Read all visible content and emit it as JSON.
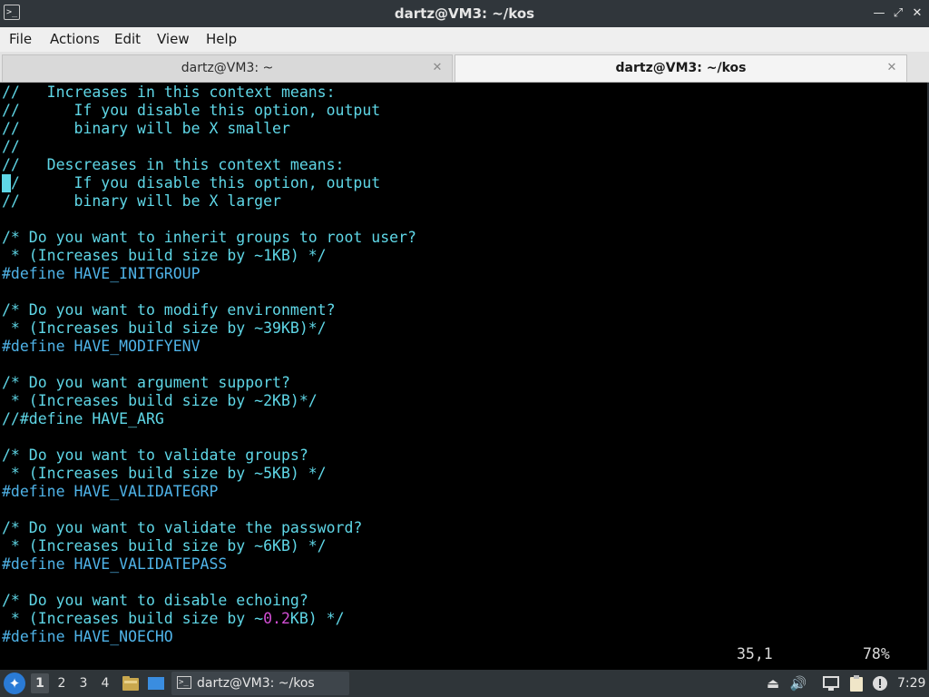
{
  "window": {
    "title": "dartz@VM3: ~/kos",
    "app_icon_glyph": ">_",
    "minimize_glyph": "—",
    "maximize_glyph": "⤢",
    "close_glyph": "✕"
  },
  "menu": [
    "File",
    "Actions",
    "Edit",
    "View",
    "Help"
  ],
  "tabs": [
    {
      "label": "dartz@VM3: ~",
      "active": false,
      "close_glyph": "✕"
    },
    {
      "label": "dartz@VM3: ~/kos",
      "active": true,
      "close_glyph": "✕"
    }
  ],
  "terminal": {
    "lines": [
      "//   Increases in this context means:",
      "//      If you disable this option, output",
      "//      binary will be X smaller",
      "//",
      "//   Descreases in this context means:",
      "//      If you disable this option, output",
      "//      binary will be X larger",
      "",
      "/* Do you want to inherit groups to root user?",
      " * (Increases build size by ~1KB) */",
      "#define HAVE_INITGROUP",
      "",
      "/* Do you want to modify environment?",
      " * (Increases build size by ~39KB)*/",
      "#define HAVE_MODIFYENV",
      "",
      "/* Do you want argument support?",
      " * (Increases build size by ~2KB)*/",
      "//#define HAVE_ARG",
      "",
      "/* Do you want to validate groups?",
      " * (Increases build size by ~5KB) */",
      "#define HAVE_VALIDATEGRP",
      "",
      "/* Do you want to validate the password?",
      " * (Increases build size by ~6KB) */",
      "#define HAVE_VALIDATEPASS",
      "",
      "/* Do you want to disable echoing?",
      " * (Increases build size by ~",
      "#define HAVE_NOECHO"
    ],
    "highlight_number": "0.2",
    "highlight_suffix": "KB) */",
    "cursor_position": "35,1",
    "scroll_percent": "78%",
    "colors": {
      "comment": "#5fd7e7",
      "preproc": "#4fb3e8",
      "number": "#d24ed4",
      "cursor": "#5fd7e7"
    }
  },
  "taskbar": {
    "workspaces": [
      "1",
      "2",
      "3",
      "4"
    ],
    "current_workspace": "1",
    "task_label": "dartz@VM3: ~/kos",
    "clock": "7:29",
    "tray_icons": [
      "eject-icon",
      "volume-icon",
      "network-icon",
      "clipboard-icon",
      "notification-icon"
    ]
  }
}
